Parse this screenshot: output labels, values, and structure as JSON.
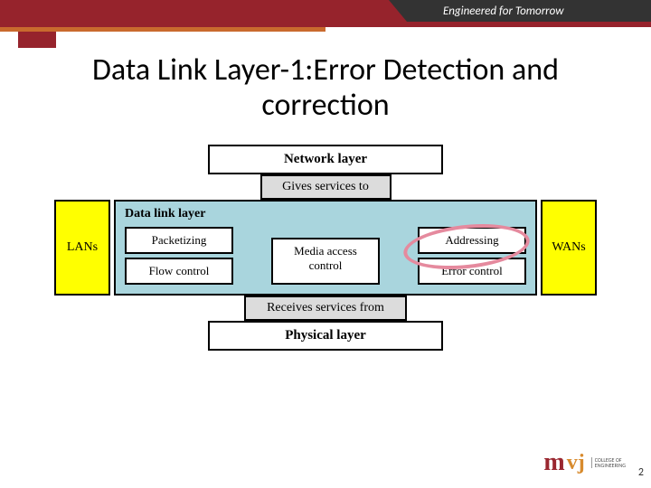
{
  "header": {
    "tagline": "Engineered for Tomorrow"
  },
  "title": "Data Link Layer-1:Error Detection and correction",
  "diagram": {
    "network_layer": "Network layer",
    "gives": "Gives services to",
    "dll_title": "Data link layer",
    "left_side": "LANs",
    "right_side": "WANs",
    "boxes": {
      "packetizing": "Packetizing",
      "addressing": "Addressing",
      "flow_control": "Flow control",
      "media_access": "Media access control",
      "error_control": "Error control"
    },
    "receives": "Receives services from",
    "physical_layer": "Physical layer"
  },
  "footer": {
    "logo_m": "m",
    "logo_vj": "vj",
    "logo_sub1": "COLLEGE OF",
    "logo_sub2": "ENGINEERING",
    "page": "2"
  }
}
